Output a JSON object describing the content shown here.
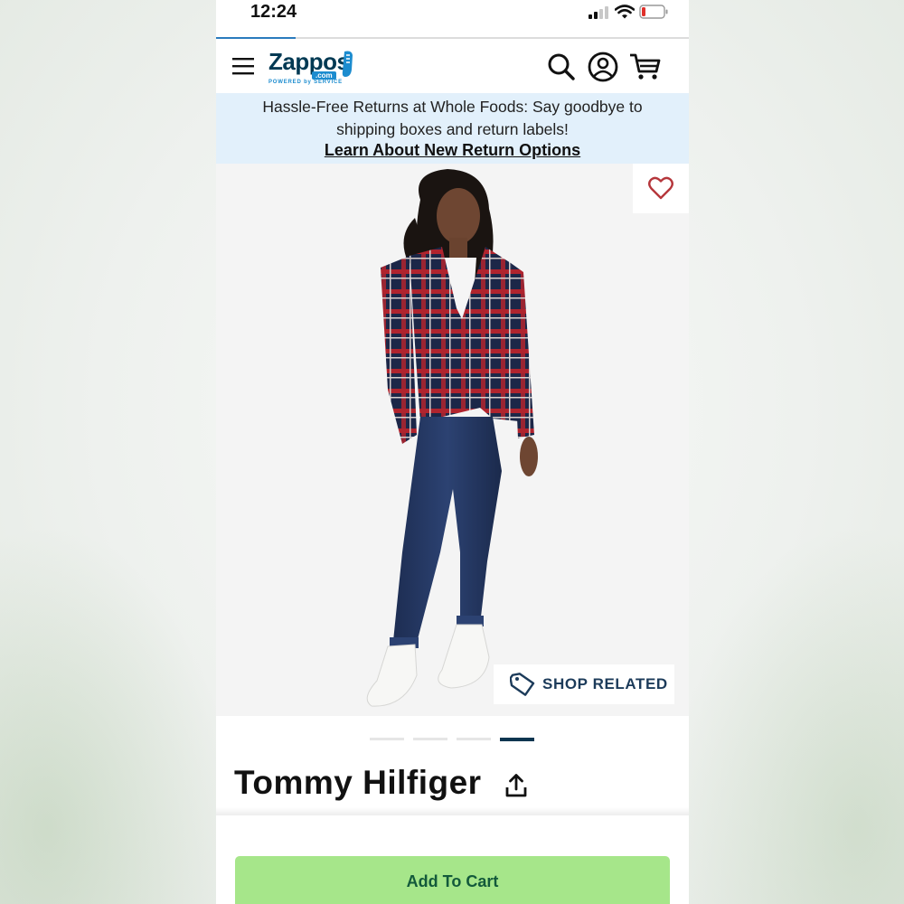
{
  "status_bar": {
    "time": "12:24"
  },
  "header": {
    "logo_text": "Zappos",
    "logo_com": ".com",
    "logo_tagline": "POWERED by SERVICE",
    "icons": [
      "menu-icon",
      "search-icon",
      "account-icon",
      "cart-icon"
    ]
  },
  "promo": {
    "text": "Hassle-Free Returns at Whole Foods: Say goodbye to shipping boxes and return labels!",
    "link": "Learn About New Return Options"
  },
  "product": {
    "favorite_icon": "heart-icon",
    "shop_related_label": "SHOP RELATED",
    "image_count": 4,
    "active_image": 4,
    "brand": "Tommy Hilfiger"
  },
  "cta": {
    "add_to_cart": "Add To Cart"
  },
  "colors": {
    "promo_bg": "#e2f0fb",
    "cta_bg": "#a6e68a",
    "cta_text": "#13593b",
    "heart": "#b5363b",
    "active_dot": "#0b3550"
  }
}
